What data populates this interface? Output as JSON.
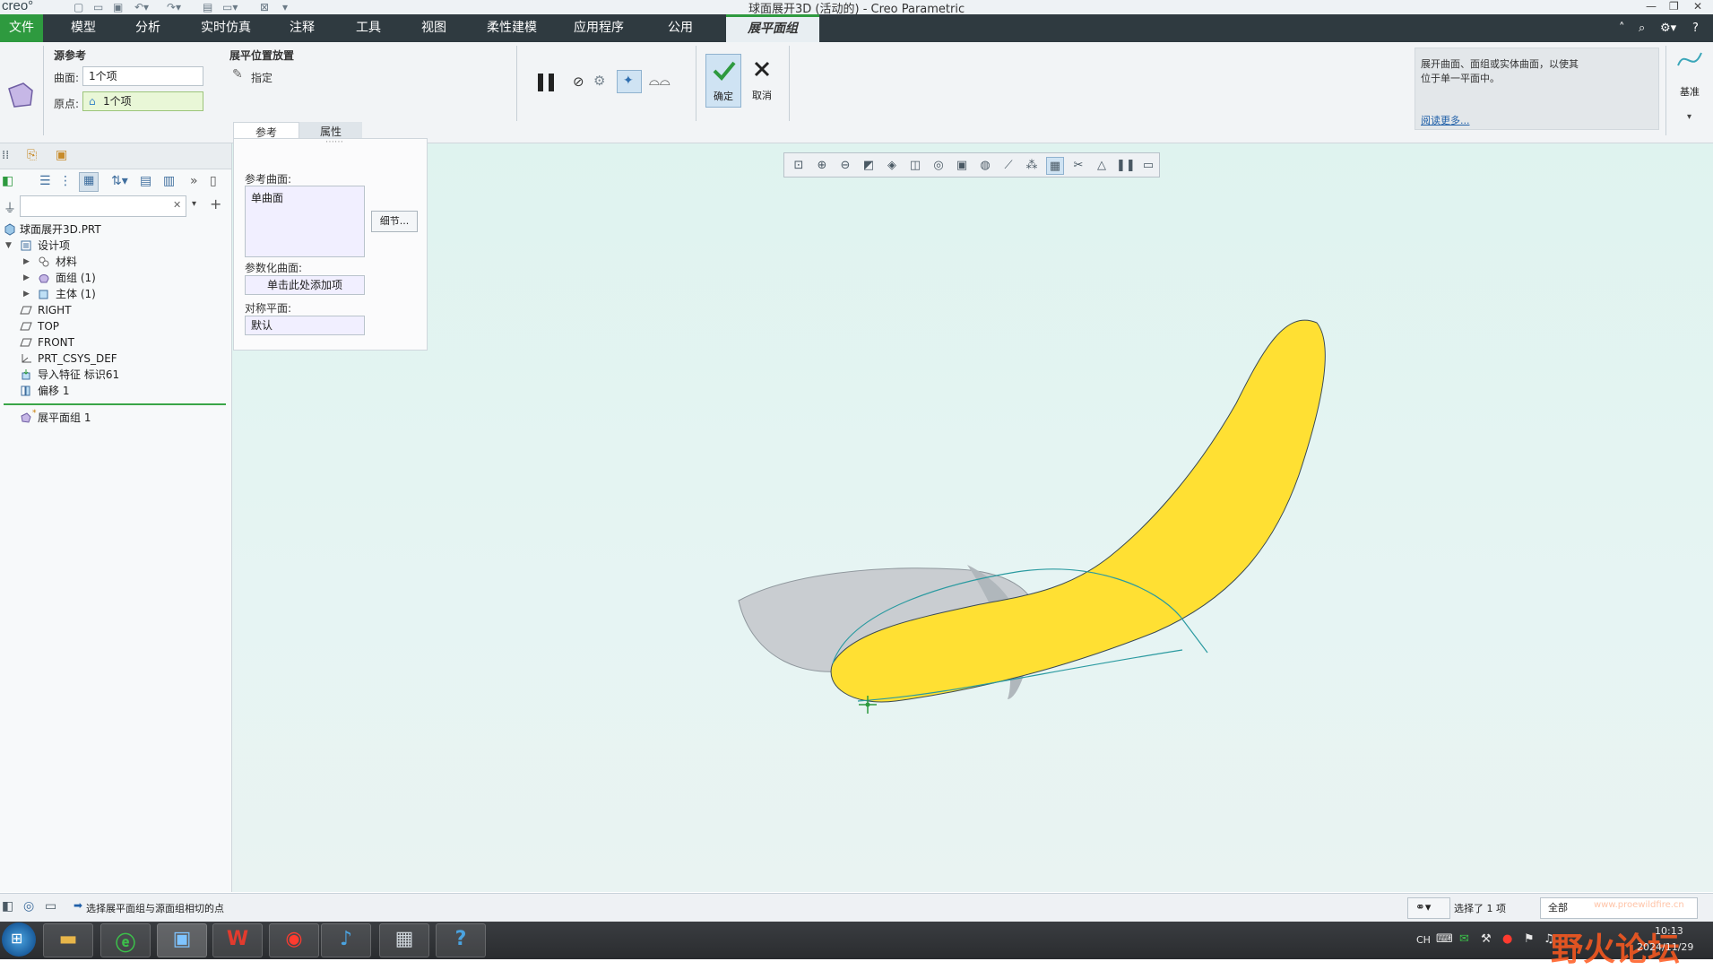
{
  "window": {
    "logo": "creo°",
    "title": "球面展开3D (活动的) - Creo Parametric"
  },
  "menu": {
    "items": [
      "文件",
      "模型",
      "分析",
      "实时仿真",
      "注释",
      "工具",
      "视图",
      "柔性建模",
      "应用程序",
      "公用",
      "展平面组"
    ],
    "active_index": 10
  },
  "ribbon": {
    "source_ref_title": "源参考",
    "surface_label": "曲面:",
    "surface_value": "1个项",
    "origin_label": "原点:",
    "origin_value": "1个项",
    "placement_title": "展平位置放置",
    "specify_label": "指定",
    "ok_label": "确定",
    "cancel_label": "取消",
    "help_text": "展开曲面、面组或实体曲面，以使其位于单一平面中。",
    "read_more": "阅读更多...",
    "datum_label": "基准",
    "tabs": [
      "参考",
      "属性"
    ]
  },
  "popup": {
    "ref_surface_label": "参考曲面:",
    "ref_surface_value": "单曲面",
    "details_button": "细节...",
    "param_surface_label": "参数化曲面:",
    "param_surface_value": "单击此处添加项",
    "sym_plane_label": "对称平面:",
    "sym_plane_value": "默认"
  },
  "tree": {
    "root": "球面展开3D.PRT",
    "items": [
      {
        "label": "设计项",
        "icon": "design-items-icon"
      },
      {
        "label": "材料",
        "icon": "material-icon"
      },
      {
        "label": "面组 (1)",
        "icon": "quilt-icon"
      },
      {
        "label": "主体 (1)",
        "icon": "body-icon"
      },
      {
        "label": "RIGHT",
        "icon": "datum-plane-icon"
      },
      {
        "label": "TOP",
        "icon": "datum-plane-icon"
      },
      {
        "label": "FRONT",
        "icon": "datum-plane-icon"
      },
      {
        "label": "PRT_CSYS_DEF",
        "icon": "csys-icon"
      },
      {
        "label": "导入特征 标识61",
        "icon": "import-feature-icon"
      },
      {
        "label": "偏移 1",
        "icon": "offset-icon"
      },
      {
        "label": "展平面组 1",
        "icon": "flatten-quilt-icon"
      }
    ]
  },
  "status": {
    "message": "选择展平面组与源面组相切的点",
    "selected": "选择了 1 项",
    "filter": "全部"
  },
  "taskbar": {
    "lang": "CH",
    "time": "10:13",
    "date": "2024/11/29",
    "watermark_text": "野火论坛",
    "watermark_url": "www.proewildfire.cn"
  },
  "colors": {
    "menubar": "#2f3a40",
    "file_green": "#2e9a3f",
    "surface_yellow": "#ffe033",
    "surface_edge": "#2a9aa0"
  }
}
